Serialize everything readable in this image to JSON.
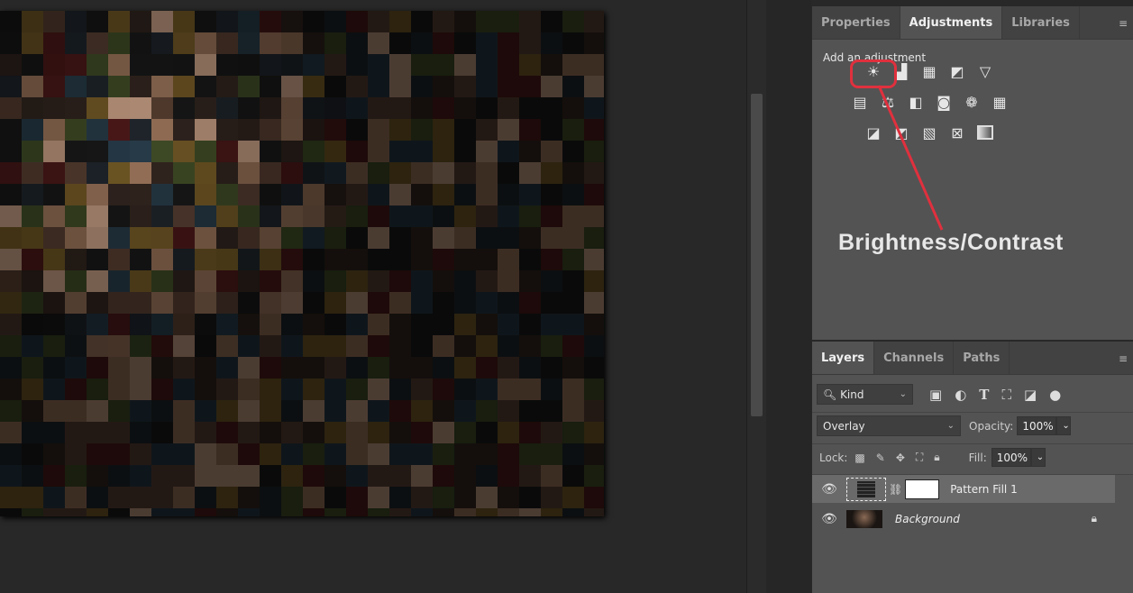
{
  "adjustments_panel": {
    "tabs": [
      {
        "label": "Properties"
      },
      {
        "label": "Adjustments",
        "active": true
      },
      {
        "label": "Libraries"
      }
    ],
    "add_label": "Add an adjustment",
    "icons_row1": [
      "brightness-contrast-icon",
      "levels-icon",
      "curves-icon",
      "exposure-icon",
      "vibrance-icon"
    ],
    "icons_row2": [
      "hue-saturation-icon",
      "color-balance-icon",
      "black-white-icon",
      "photo-filter-icon",
      "channel-mixer-icon",
      "color-lookup-icon"
    ],
    "icons_row3": [
      "invert-icon",
      "posterize-icon",
      "threshold-icon",
      "selective-color-icon",
      "gradient-map-icon"
    ]
  },
  "annotation": {
    "text": "Brightness/Contrast",
    "color": "#e0303e"
  },
  "layers_panel": {
    "tabs": [
      {
        "label": "Layers",
        "active": true
      },
      {
        "label": "Channels"
      },
      {
        "label": "Paths"
      }
    ],
    "filter_kind": "Kind",
    "blend_mode": "Overlay",
    "opacity_label": "Opacity:",
    "opacity_value": "100%",
    "lock_label": "Lock:",
    "fill_label": "Fill:",
    "fill_value": "100%",
    "layers": [
      {
        "name": "Pattern Fill 1",
        "visible": true,
        "selected": true
      },
      {
        "name": "Background",
        "visible": true,
        "locked": true
      }
    ]
  }
}
